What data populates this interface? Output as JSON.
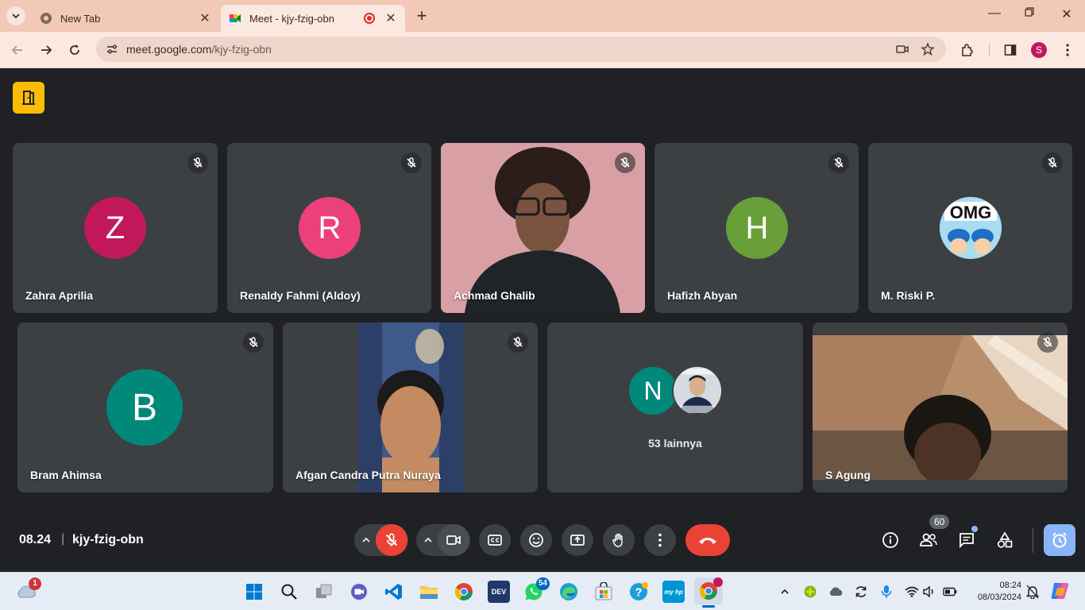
{
  "browser": {
    "tabs": [
      {
        "title": "New Tab",
        "active": false
      },
      {
        "title": "Meet - kjy-fzig-obn",
        "active": true,
        "recording": true
      }
    ],
    "url_host": "meet.google.com",
    "url_path": "/kjy-fzig-obn",
    "profile_initial": "S"
  },
  "meeting": {
    "time": "08.24",
    "separator": "|",
    "code": "kjy-fzig-obn",
    "participant_count": "60",
    "participants_row1": [
      {
        "name": "Zahra Aprilia",
        "initial": "Z",
        "color": "#c2185b",
        "muted": true
      },
      {
        "name": "Renaldy Fahmi (Aldoy)",
        "initial": "R",
        "color": "#ec407a",
        "muted": true
      },
      {
        "name": "Achmad Ghalib",
        "initial": "",
        "color": "",
        "muted": true,
        "video": true
      },
      {
        "name": "Hafizh Abyan",
        "initial": "H",
        "color": "#689f38",
        "muted": true
      },
      {
        "name": "M. Riski P.",
        "initial": "",
        "color": "",
        "muted": true,
        "avatar_image_text": "OMG"
      }
    ],
    "participants_row2": [
      {
        "name": "Bram Ahimsa",
        "initial": "B",
        "color": "#00897b",
        "muted": true
      },
      {
        "name": "Afgan Candra Putra Nuraya",
        "initial": "",
        "muted": true,
        "video": true
      },
      {
        "name": "",
        "initial": "N",
        "color": "#00897b",
        "others_label": "53 lainnya"
      },
      {
        "name": "S Agung",
        "initial": "",
        "muted": true,
        "video": true
      }
    ]
  },
  "taskbar": {
    "weather_badge": "1",
    "whatsapp_badge": "54",
    "dev_label": "DEV",
    "myhp_label": "my hp",
    "clock_time": "08:24",
    "clock_date": "08/03/2024"
  },
  "colors": {
    "meet_bg": "#202124",
    "tile_bg": "#3c4043",
    "end_call": "#ea4335",
    "accent_blue": "#8ab4f8",
    "meet_logo": "#fbbc04"
  }
}
